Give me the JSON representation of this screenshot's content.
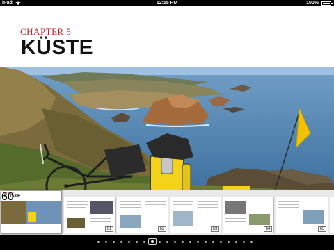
{
  "status_bar": {
    "carrier": "iPad",
    "time": "12:15 PM",
    "battery": "100%"
  },
  "chapter": {
    "label": "CHAPTER 5",
    "title": "KÜSTE"
  },
  "thumbnails": {
    "current_mini_label": "CHAPTER 5",
    "current_mini_title": "KÜSTE",
    "page_numbers": [
      "60",
      "61",
      "62",
      "63",
      "64",
      "65"
    ]
  },
  "page_indicator": {
    "dot_count": 21,
    "current_index": 7
  },
  "colors": {
    "chapter_label": "#c0272d",
    "flag": "#f2c200",
    "bag": "#f3d21a"
  }
}
